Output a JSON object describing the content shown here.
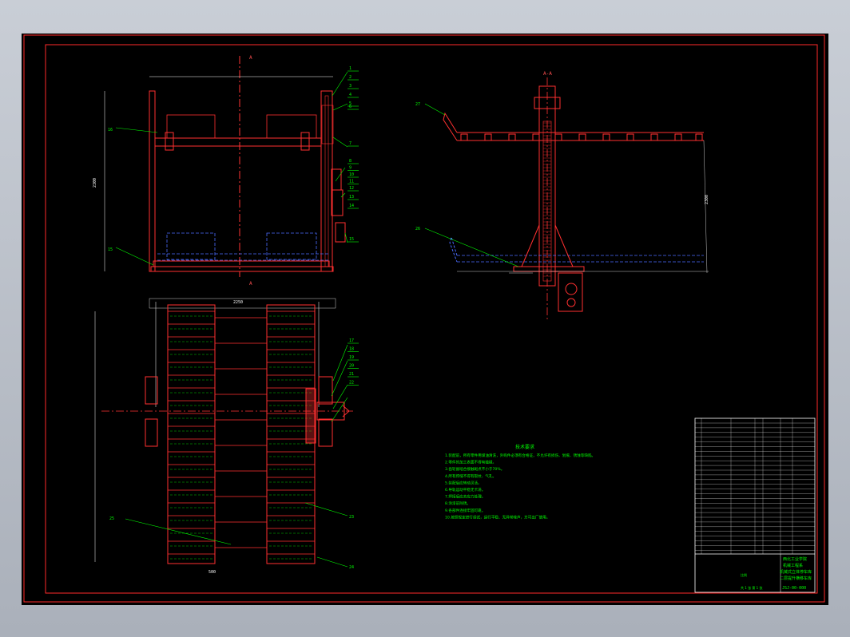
{
  "drawing": {
    "section_marker": "A",
    "section_marker_top": "A-A",
    "callouts_front": [
      "1",
      "2",
      "3",
      "4",
      "5",
      "6",
      "7",
      "8",
      "9",
      "10",
      "11",
      "12",
      "13",
      "14",
      "15",
      "16"
    ],
    "callouts_plan": [
      "17",
      "18",
      "19",
      "20",
      "21",
      "22",
      "23",
      "24",
      "25"
    ],
    "callouts_side": [
      "26",
      "27"
    ],
    "tech_title": "技术要求",
    "tech_notes": [
      "1.装配前，所有零件用煤油清洗，外购件必须有合格证，不允许有损伤、划痕、锈蚀等缺陷。",
      "2.零件的加工表面不得有磕碰。",
      "3.齿轮副啮合接触斑点不小于70%。",
      "4.所有焊缝不得有裂纹、气孔。",
      "5.装配后应转动灵活。",
      "6.导轨运动平稳无卡滞。",
      "7.焊接后应去应力处理。",
      "8.涂漆前除锈。",
      "9.各部件连接牢固可靠。",
      "10.按照规定进行调试，运行平稳、无异常噪声，方可出厂使用。"
    ],
    "title_block": {
      "school": "西北工业学院",
      "dept": "机械工程系",
      "name": "机械式立体停车库",
      "name2": "二层提升横移车库",
      "drawing_no": "JSJ-00-000",
      "scale_label": "比例",
      "sheet": "共 1 张 第 1 张"
    }
  }
}
